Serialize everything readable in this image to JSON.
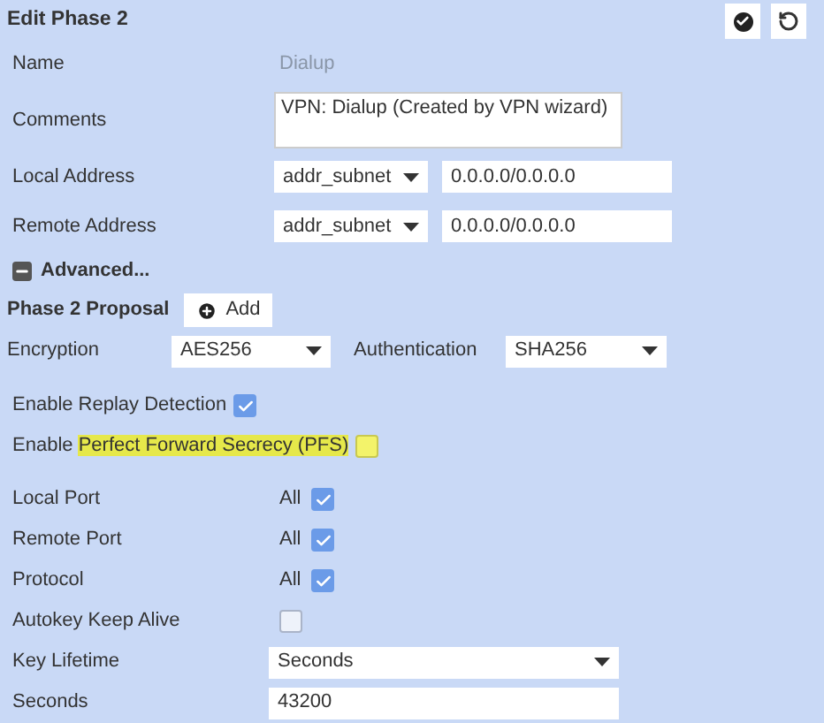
{
  "header": {
    "title": "Edit Phase 2",
    "buttons": [
      {
        "kind": "apply"
      },
      {
        "kind": "revert"
      }
    ]
  },
  "fields": [
    {
      "kind": "static",
      "label": "Name",
      "value": "Dialup"
    },
    {
      "kind": "textarea",
      "label": "Comments",
      "value": "VPN: Dialup (Created by VPN wizard)"
    },
    {
      "kind": "address",
      "label": "Local Address",
      "type": "addr_subnet",
      "value": "0.0.0.0/0.0.0.0"
    },
    {
      "kind": "address",
      "label": "Remote Address",
      "type": "addr_subnet",
      "value": "0.0.0.0/0.0.0.0"
    }
  ],
  "advanced": {
    "label": "Advanced...",
    "expanded": true
  },
  "proposal": {
    "label": "Phase 2 Proposal",
    "add_button": "Add",
    "encryption_label": "Encryption",
    "encryption": "AES256",
    "authentication_label": "Authentication",
    "authentication": "SHA256"
  },
  "options": [
    {
      "kind": "check",
      "label": "Enable Replay Detection",
      "checked": true,
      "highlighted": false
    },
    {
      "kind": "check",
      "label": "Enable",
      "highlight_text": "Perfect Forward Secrecy (PFS)",
      "checked": false,
      "highlighted": true
    }
  ],
  "settings": [
    {
      "kind": "check",
      "label": "Local Port",
      "value": "All",
      "checked": true
    },
    {
      "kind": "check",
      "label": "Remote Port",
      "value": "All",
      "checked": true
    },
    {
      "kind": "check",
      "label": "Protocol",
      "value": "All",
      "checked": true
    },
    {
      "kind": "check",
      "label": "Autokey Keep Alive",
      "checked": false
    },
    {
      "kind": "select",
      "label": "Key Lifetime",
      "value": "Seconds"
    },
    {
      "kind": "input",
      "label": "Seconds",
      "value": "43200"
    }
  ]
}
